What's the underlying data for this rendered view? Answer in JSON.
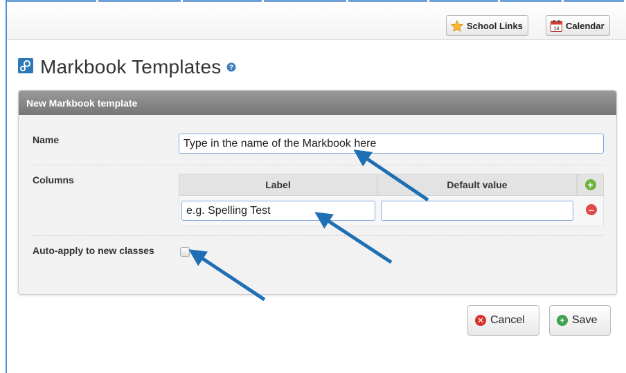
{
  "toolbar": {
    "school_links_label": "School Links",
    "calendar_label": "Calendar",
    "calendar_icon_text": "14"
  },
  "page": {
    "title": "Markbook Templates"
  },
  "panel": {
    "header": "New Markbook template",
    "name_label": "Name",
    "name_value": "Type in the name of the Markbook here",
    "columns_label": "Columns",
    "columns_table": {
      "headers": [
        "Label",
        "Default value"
      ],
      "rows": [
        {
          "label_value": "e.g. Spelling Test",
          "default_value": ""
        }
      ]
    },
    "auto_apply_label": "Auto-apply to new classes",
    "auto_apply_checked": false
  },
  "actions": {
    "cancel_label": "Cancel",
    "save_label": "Save"
  },
  "colors": {
    "accent_blue": "#4a90d9",
    "arrow_blue": "#1f6fb5",
    "panel_header": "#808080",
    "add_green": "#6db33f",
    "remove_red": "#e04a4a",
    "cancel_red": "#d9302b",
    "save_green": "#3fa34d"
  },
  "icons": {
    "school_links": "star-icon",
    "calendar": "calendar-icon",
    "page": "markbook-icon",
    "help": "help-icon",
    "add_column": "plus-circle-icon",
    "remove_column": "minus-circle-icon",
    "cancel": "x-circle-icon",
    "save": "check-circle-icon"
  }
}
